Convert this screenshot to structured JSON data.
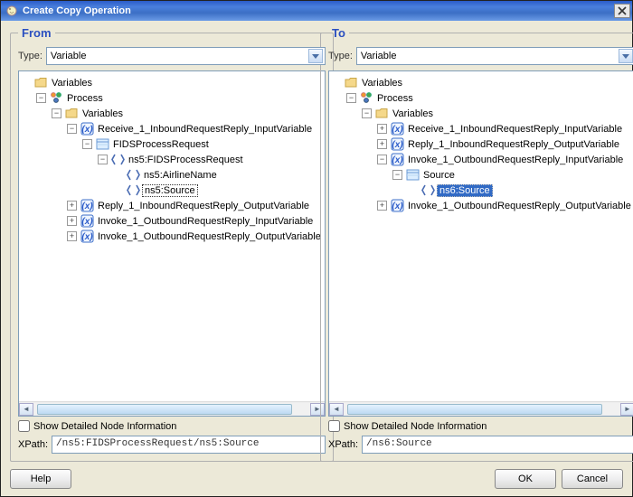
{
  "window": {
    "title": "Create Copy Operation"
  },
  "panel_from": {
    "title": "From",
    "type_label": "Type:",
    "type_value": "Variable",
    "tree": [
      {
        "level": 0,
        "exp": "",
        "icon": "folder",
        "label": "Variables",
        "sel": ""
      },
      {
        "level": 1,
        "exp": "−",
        "icon": "proc",
        "label": "Process",
        "sel": ""
      },
      {
        "level": 2,
        "exp": "−",
        "icon": "folder",
        "label": "Variables",
        "sel": ""
      },
      {
        "level": 3,
        "exp": "−",
        "icon": "var",
        "label": "Receive_1_InboundRequestReply_InputVariable",
        "sel": ""
      },
      {
        "level": 4,
        "exp": "−",
        "icon": "msg",
        "label": "FIDSProcessRequest",
        "sel": ""
      },
      {
        "level": 5,
        "exp": "−",
        "icon": "elem",
        "label": "ns5:FIDSProcessRequest",
        "sel": ""
      },
      {
        "level": 6,
        "exp": "",
        "icon": "elem",
        "label": "ns5:AirlineName",
        "sel": ""
      },
      {
        "level": 6,
        "exp": "",
        "icon": "elem",
        "label": "ns5:Source",
        "sel": "from"
      },
      {
        "level": 3,
        "exp": "+",
        "icon": "var",
        "label": "Reply_1_InboundRequestReply_OutputVariable",
        "sel": ""
      },
      {
        "level": 3,
        "exp": "+",
        "icon": "var",
        "label": "Invoke_1_OutboundRequestReply_InputVariable",
        "sel": ""
      },
      {
        "level": 3,
        "exp": "+",
        "icon": "var",
        "label": "Invoke_1_OutboundRequestReply_OutputVariable",
        "sel": ""
      }
    ],
    "show_detailed": "Show Detailed Node Information",
    "xpath_label": "XPath:",
    "xpath_value": "/ns5:FIDSProcessRequest/ns5:Source"
  },
  "panel_to": {
    "title": "To",
    "type_label": "Type:",
    "type_value": "Variable",
    "tree": [
      {
        "level": 0,
        "exp": "",
        "icon": "folder",
        "label": "Variables",
        "sel": ""
      },
      {
        "level": 1,
        "exp": "−",
        "icon": "proc",
        "label": "Process",
        "sel": ""
      },
      {
        "level": 2,
        "exp": "−",
        "icon": "folder",
        "label": "Variables",
        "sel": ""
      },
      {
        "level": 3,
        "exp": "+",
        "icon": "var",
        "label": "Receive_1_InboundRequestReply_InputVariable",
        "sel": ""
      },
      {
        "level": 3,
        "exp": "+",
        "icon": "var",
        "label": "Reply_1_InboundRequestReply_OutputVariable",
        "sel": ""
      },
      {
        "level": 3,
        "exp": "−",
        "icon": "var",
        "label": "Invoke_1_OutboundRequestReply_InputVariable",
        "sel": ""
      },
      {
        "level": 4,
        "exp": "−",
        "icon": "msg",
        "label": "Source",
        "sel": ""
      },
      {
        "level": 5,
        "exp": "",
        "icon": "elem",
        "label": "ns6:Source",
        "sel": "to"
      },
      {
        "level": 3,
        "exp": "+",
        "icon": "var",
        "label": "Invoke_1_OutboundRequestReply_OutputVariable",
        "sel": ""
      }
    ],
    "show_detailed": "Show Detailed Node Information",
    "xpath_label": "XPath:",
    "xpath_value": "/ns6:Source"
  },
  "buttons": {
    "help": "Help",
    "ok": "OK",
    "cancel": "Cancel"
  },
  "icons": {
    "folder": "folder-icon",
    "proc": "process-icon",
    "var": "variable-icon",
    "msg": "message-part-icon",
    "elem": "element-icon"
  }
}
